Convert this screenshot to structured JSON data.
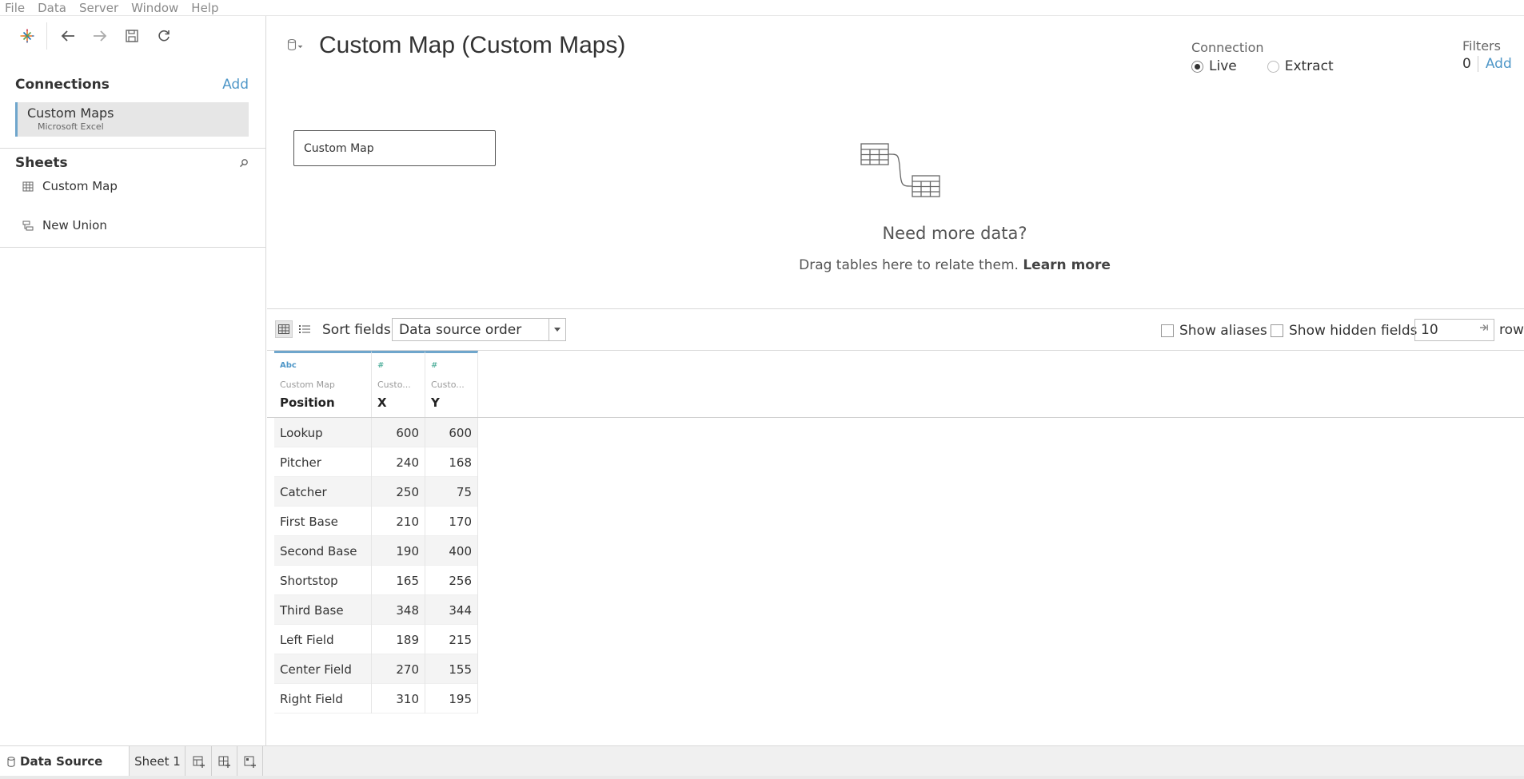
{
  "menu": [
    "File",
    "Data",
    "Server",
    "Window",
    "Help"
  ],
  "toolbar": {
    "logo_icon": "tableau-logo-icon",
    "back_icon": "arrow-left-icon",
    "forward_icon": "arrow-right-icon",
    "save_icon": "save-icon",
    "refresh_icon": "refresh-icon"
  },
  "connections": {
    "header": "Connections",
    "add_label": "Add",
    "items": [
      {
        "name": "Custom Maps",
        "type": "Microsoft Excel"
      }
    ]
  },
  "sheets": {
    "header": "Sheets",
    "items": [
      {
        "label": "Custom Map",
        "icon": "table-icon"
      },
      {
        "label": "New Union",
        "icon": "union-icon"
      }
    ]
  },
  "datasource": {
    "title": "Custom Map (Custom Maps)",
    "connection_label": "Connection",
    "connection_options": [
      "Live",
      "Extract"
    ],
    "connection_selected": "Live",
    "filters_label": "Filters",
    "filters_count": "0",
    "filters_add": "Add",
    "canvas_table": "Custom Map",
    "need_more_title": "Need more data?",
    "drag_text": "Drag tables here to relate them.",
    "learn_more": "Learn more"
  },
  "grid_toolbar": {
    "sort_label": "Sort fields",
    "sort_value": "Data source order",
    "show_aliases": "Show aliases",
    "show_hidden": "Show hidden fields",
    "rows_value": "10",
    "rows_label": "rows"
  },
  "grid": {
    "columns": [
      {
        "type": "Abc",
        "source": "Custom Map",
        "name": "Position"
      },
      {
        "type": "#",
        "source": "Custo...",
        "name": "X"
      },
      {
        "type": "#",
        "source": "Custo...",
        "name": "Y"
      }
    ],
    "rows": [
      {
        "position": "Lookup",
        "x": "600",
        "y": "600"
      },
      {
        "position": "Pitcher",
        "x": "240",
        "y": "168"
      },
      {
        "position": "Catcher",
        "x": "250",
        "y": "75"
      },
      {
        "position": "First Base",
        "x": "210",
        "y": "170"
      },
      {
        "position": "Second Base",
        "x": "190",
        "y": "400"
      },
      {
        "position": "Shortstop",
        "x": "165",
        "y": "256"
      },
      {
        "position": "Third Base",
        "x": "348",
        "y": "344"
      },
      {
        "position": "Left Field",
        "x": "189",
        "y": "215"
      },
      {
        "position": "Center Field",
        "x": "270",
        "y": "155"
      },
      {
        "position": "Right Field",
        "x": "310",
        "y": "195"
      }
    ]
  },
  "tabs": {
    "datasource": "Data Source",
    "sheet1": "Sheet 1"
  },
  "colors": {
    "accent_blue": "#4f97c8",
    "numeric_green": "#3aa58f",
    "selection_border": "#6fa6cc"
  }
}
